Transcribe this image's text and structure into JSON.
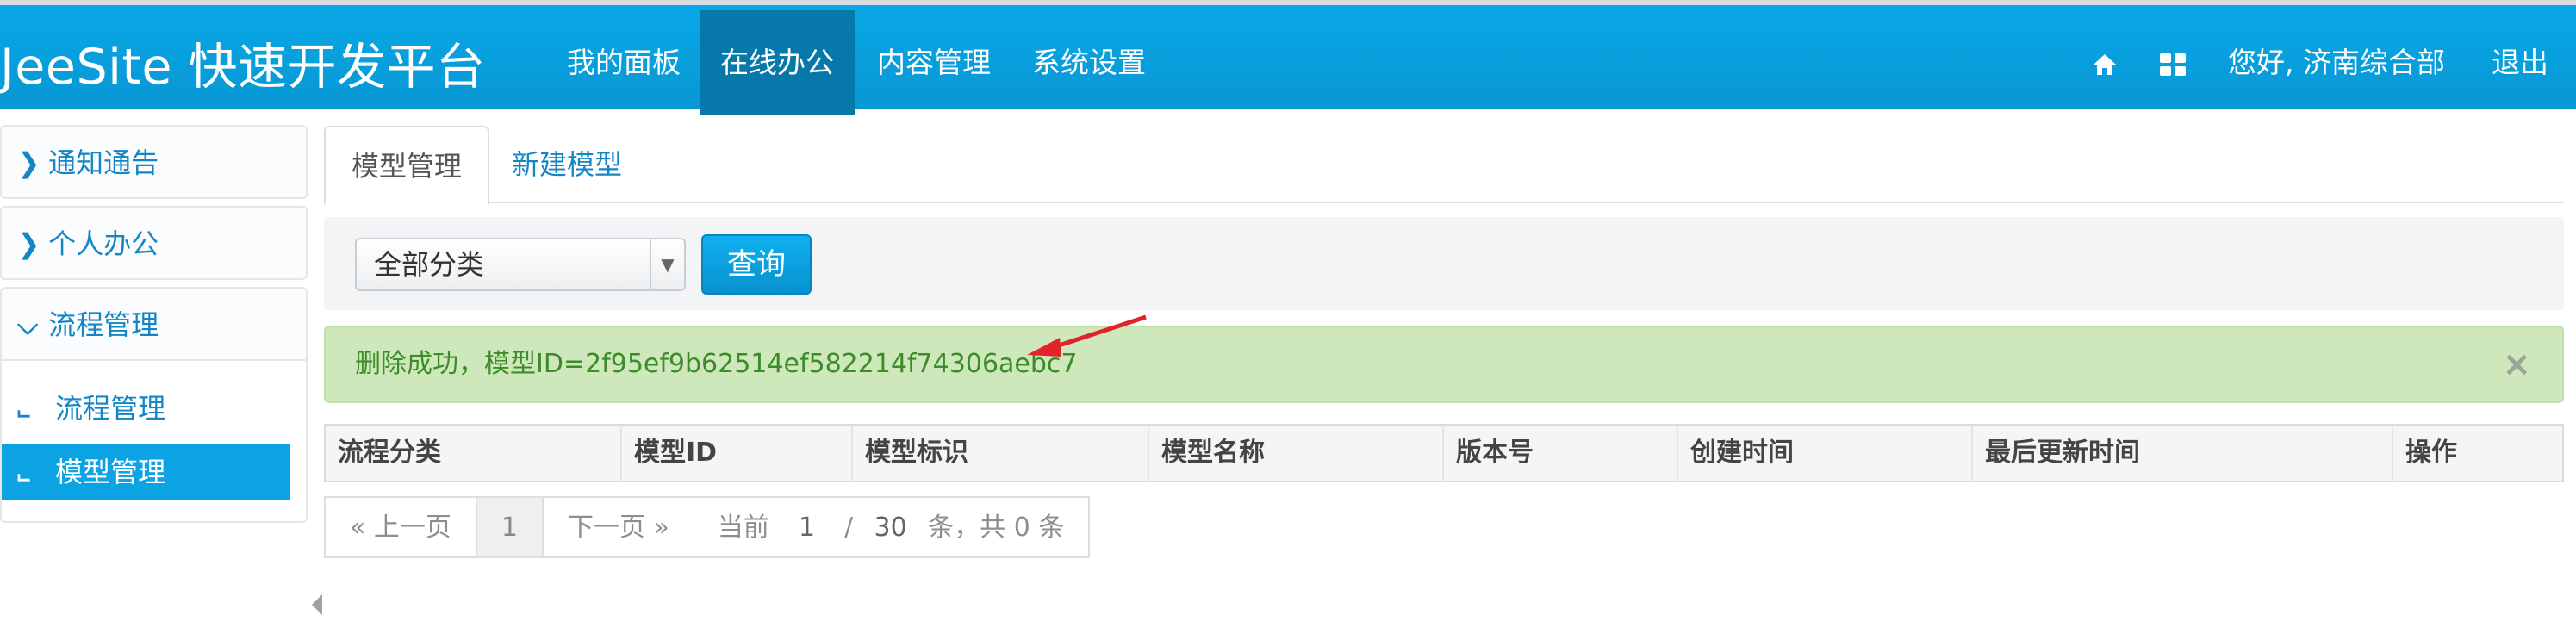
{
  "header": {
    "brand": "JeeSite 快速开发平台",
    "nav": [
      {
        "label": "我的面板",
        "active": false
      },
      {
        "label": "在线办公",
        "active": true
      },
      {
        "label": "内容管理",
        "active": false
      },
      {
        "label": "系统设置",
        "active": false
      }
    ],
    "greeting": "您好, 济南综合部",
    "logout": "退出",
    "icons": [
      "home-icon",
      "grid-icon"
    ]
  },
  "sidebar": {
    "groups": [
      {
        "label": "通知通告",
        "expanded": false
      },
      {
        "label": "个人办公",
        "expanded": false
      },
      {
        "label": "流程管理",
        "expanded": true,
        "items": [
          {
            "label": "流程管理",
            "active": false
          },
          {
            "label": "模型管理",
            "active": true
          }
        ]
      }
    ]
  },
  "tabs": [
    {
      "label": "模型管理",
      "active": true
    },
    {
      "label": "新建模型",
      "active": false
    }
  ],
  "search": {
    "category_value": "全部分类",
    "query_label": "查询"
  },
  "alert": {
    "message": "删除成功，模型ID=2f95ef9b62514ef582214f74306aebc7",
    "close": "×"
  },
  "table": {
    "columns": [
      "流程分类",
      "模型ID",
      "模型标识",
      "模型名称",
      "版本号",
      "创建时间",
      "最后更新时间",
      "操作"
    ],
    "rows": []
  },
  "pager": {
    "prev": "« 上一页",
    "current": "1",
    "next": "下一页 »",
    "current_label": "当前",
    "page_input": "1",
    "separator": "/",
    "page_size": "30",
    "total_label": "条，共 0 条"
  },
  "colors": {
    "nav_bg": "#0aa7e6",
    "nav_active": "#0678a9",
    "link": "#1386c6",
    "alert_bg": "#cfe8bb",
    "alert_text": "#3c8c2a",
    "annotation_arrow": "#e0242a"
  }
}
